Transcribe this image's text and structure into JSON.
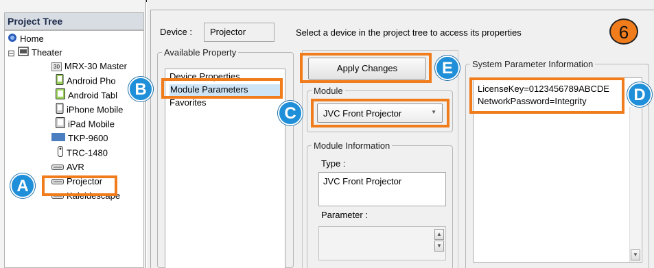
{
  "tree": {
    "title": "Project Tree",
    "home": "Home",
    "theater": "Theater",
    "expander": "⊟",
    "mrx_badge": "30",
    "items": {
      "mrx": "MRX-30 Master",
      "android_phone": "Android Pho",
      "android_tablet": "Android Tabl",
      "iphone": "iPhone Mobile",
      "ipad": "iPad Mobile",
      "tkp": "TKP-9600",
      "trc": "TRC-1480",
      "avr": "AVR",
      "projector": "Projector",
      "kaleidescape": "Kaleidescape"
    }
  },
  "device": {
    "label": "Device :",
    "value": "Projector",
    "hint": "Select a device in the project tree to access its properties"
  },
  "available_property": {
    "legend": "Available Property",
    "items": [
      "Device Properties",
      "Module Parameters",
      "Favorites"
    ]
  },
  "apply_button": "Apply Changes",
  "module": {
    "legend": "Module",
    "selected": "JVC Front Projector"
  },
  "module_info": {
    "legend": "Module Information",
    "type_label": "Type :",
    "type_value": "JVC Front Projector",
    "parameter_label": "Parameter :"
  },
  "system_params": {
    "legend": "System Parameter Information",
    "line1": "LicenseKey=0123456789ABCDE",
    "line2": "NetworkPassword=Integrity"
  },
  "callouts": {
    "A": "A",
    "B": "B",
    "C": "C",
    "D": "D",
    "E": "E",
    "step": "6"
  },
  "colors": {
    "callout_border": "#f07c1c",
    "badge_blue": "#1e8fd8",
    "step_circle": "#f07c1c",
    "selection": "#cde4f7"
  }
}
